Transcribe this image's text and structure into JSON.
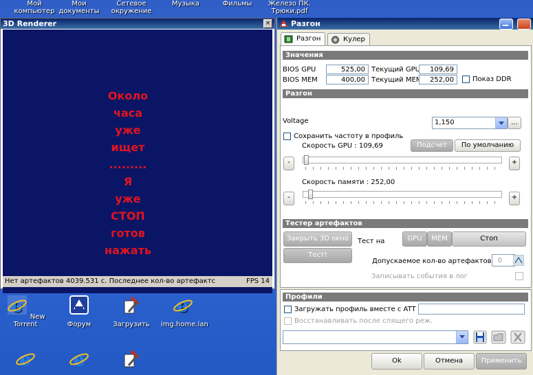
{
  "desktop": {
    "top_icons": [
      "Мой\nкомпьютер",
      "Мои\nдокументы",
      "Сетевое\nокружение",
      "Музыка",
      "Фильмы",
      "Железо ПК.\nТрюки.pdf"
    ],
    "icons": [
      {
        "label": "New Torrent",
        "icon": "ie-icon"
      },
      {
        "label": "Форум",
        "icon": "forum-icon"
      },
      {
        "label": "Загрузить",
        "icon": "download-icon"
      },
      {
        "label": "img.home.lan",
        "icon": "ie-icon"
      }
    ]
  },
  "renderer": {
    "title": "3D Renderer",
    "message_lines": [
      "Около",
      "часа",
      "уже",
      "ищет",
      ".........",
      "Я",
      "уже",
      "СТОП",
      "готов",
      "нажать"
    ],
    "status_left": "Нет артефактов 4039.531 с. Последнее кол-во артефактс",
    "status_right": "FPS 14"
  },
  "overclock": {
    "title": "Разгон",
    "tabs": [
      "Разгон",
      "Кулер"
    ],
    "values": {
      "header": "Значения",
      "bios_gpu_label": "BIOS GPU",
      "bios_gpu": "525,00",
      "bios_mem_label": "BIOS MEM",
      "bios_mem": "400,00",
      "cur_gpu_label": "Текущий GPU",
      "cur_gpu": "109,69",
      "cur_mem_label": "Текущий MEM",
      "cur_mem": "252,00",
      "show_ddr": "Показ DDR"
    },
    "oc": {
      "header": "Разгон",
      "voltage_label": "Voltage",
      "voltage": "1,150",
      "dots": "...",
      "save_freq": "Сохранить частоту в профиль",
      "gpu_speed": "Скорость GPU : 109,69",
      "calc": "Подсчет",
      "default": "По умолчанию",
      "mem_speed": "Скорость памяти : 252,00",
      "minus": "-",
      "plus": "+",
      "gpu_slider_fraction": 0.0,
      "mem_slider_fraction": 0.02
    },
    "artifacts": {
      "header": "Тестер артефактов",
      "close_3d": "Закрыть 3D окно",
      "test_on": "Тест на",
      "gpu": "GPU",
      "mem": "MEM",
      "stop": "Стоп",
      "test": "Тест!",
      "allowed": "Допускаемое кол-во артефактов",
      "allowed_value": "0",
      "log": "Записывать события в лог"
    },
    "profiles": {
      "header": "Профили",
      "load_with_att": "Загружать профиль вместе с ATT",
      "restore": "Восстанавливать после спящего реж."
    },
    "buttons": {
      "ok": "Ok",
      "cancel": "Отмена",
      "apply": "Применить"
    }
  }
}
